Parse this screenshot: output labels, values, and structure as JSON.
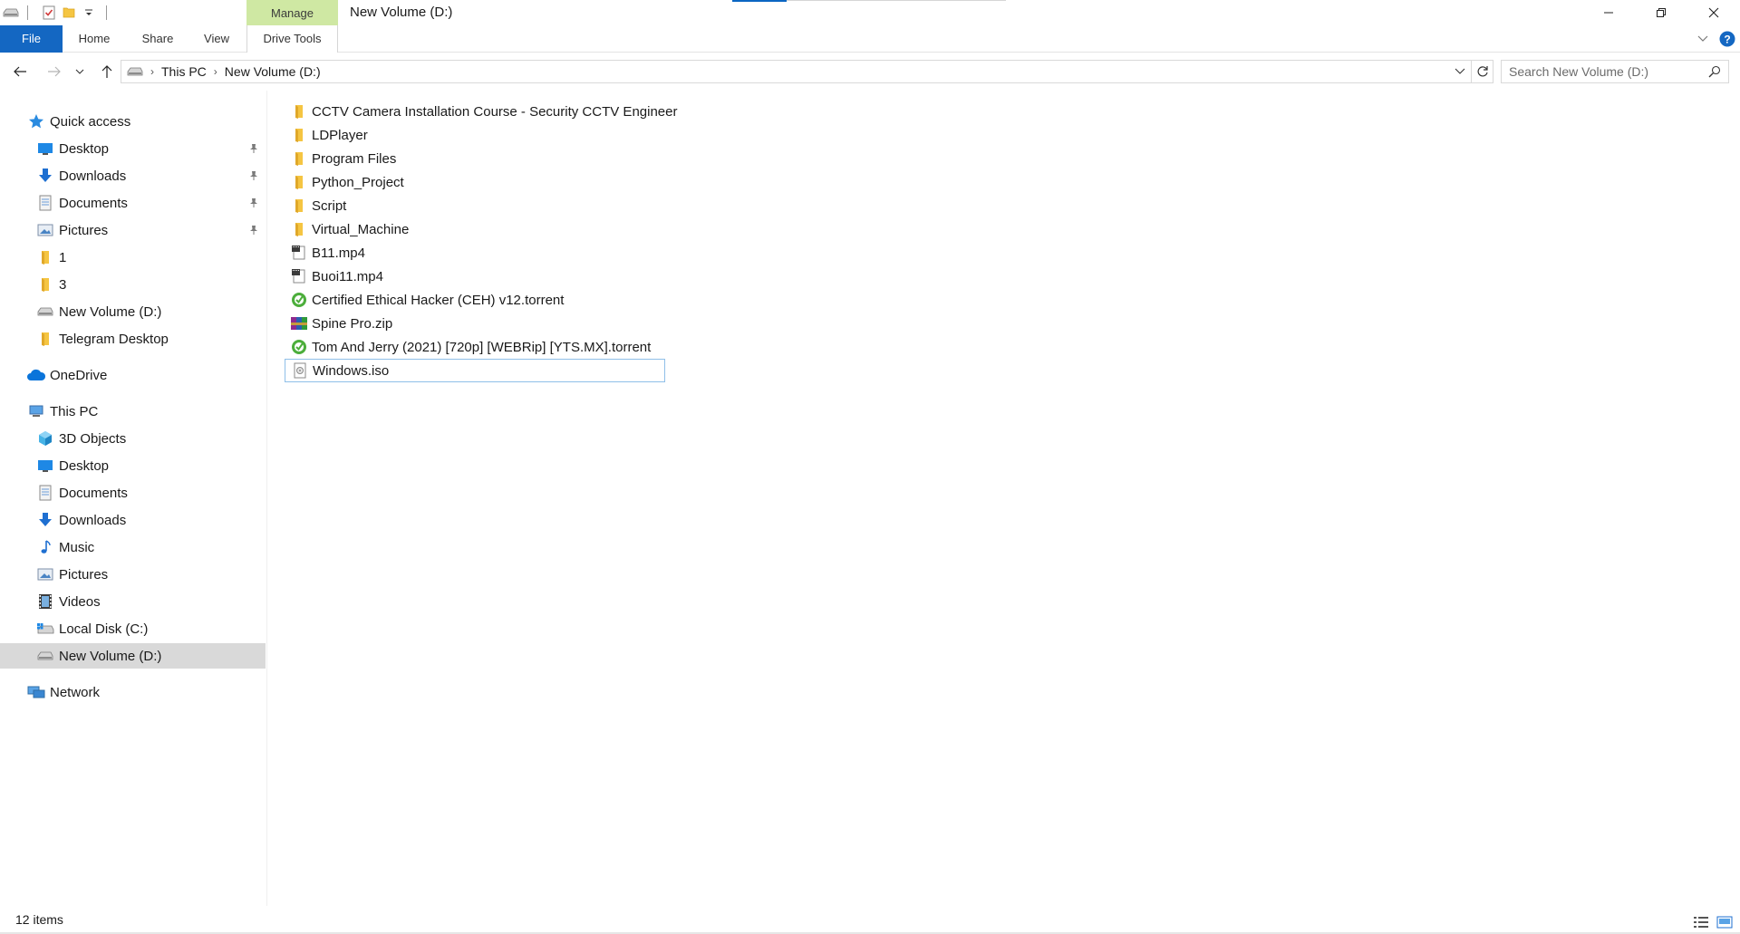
{
  "window": {
    "title": "New Volume (D:)",
    "context_tab": "Manage",
    "accent_color": "#0b66c2",
    "file_tab_color": "#1467c2",
    "manage_color": "#cfe8a3"
  },
  "ribbon": {
    "tabs": [
      "File",
      "Home",
      "Share",
      "View",
      "Drive Tools"
    ]
  },
  "address": {
    "crumbs": [
      "This PC",
      "New Volume (D:)"
    ],
    "search_placeholder": "Search New Volume (D:)"
  },
  "sidebar": {
    "quick_access": "Quick access",
    "quick_items": [
      {
        "label": "Desktop",
        "icon": "desktop-icon",
        "pinned": true
      },
      {
        "label": "Downloads",
        "icon": "downloads-icon",
        "pinned": true
      },
      {
        "label": "Documents",
        "icon": "documents-icon",
        "pinned": true
      },
      {
        "label": "Pictures",
        "icon": "pictures-icon",
        "pinned": true
      },
      {
        "label": "1",
        "icon": "folder-icon",
        "pinned": false
      },
      {
        "label": "3",
        "icon": "folder-icon",
        "pinned": false
      },
      {
        "label": "New Volume (D:)",
        "icon": "drive-icon",
        "pinned": false
      },
      {
        "label": "Telegram Desktop",
        "icon": "folder-icon",
        "pinned": false
      }
    ],
    "onedrive": "OneDrive",
    "this_pc": "This PC",
    "pc_items": [
      {
        "label": "3D Objects",
        "icon": "3d-objects-icon"
      },
      {
        "label": "Desktop",
        "icon": "desktop-icon"
      },
      {
        "label": "Documents",
        "icon": "documents-icon"
      },
      {
        "label": "Downloads",
        "icon": "downloads-icon"
      },
      {
        "label": "Music",
        "icon": "music-icon"
      },
      {
        "label": "Pictures",
        "icon": "pictures-icon"
      },
      {
        "label": "Videos",
        "icon": "videos-icon"
      },
      {
        "label": "Local Disk (C:)",
        "icon": "local-disk-icon"
      },
      {
        "label": "New Volume (D:)",
        "icon": "drive-icon"
      }
    ],
    "network": "Network"
  },
  "files": [
    {
      "name": "CCTV Camera Installation Course - Security CCTV Engineer",
      "icon": "folder-icon"
    },
    {
      "name": "LDPlayer",
      "icon": "folder-icon"
    },
    {
      "name": "Program Files",
      "icon": "folder-icon"
    },
    {
      "name": "Python_Project",
      "icon": "folder-icon"
    },
    {
      "name": "Script",
      "icon": "folder-icon"
    },
    {
      "name": "Virtual_Machine",
      "icon": "folder-icon"
    },
    {
      "name": "B11.mp4",
      "icon": "video-file-icon"
    },
    {
      "name": "Buoi11.mp4",
      "icon": "video-file-icon"
    },
    {
      "name": "Certified Ethical Hacker (CEH) v12.torrent",
      "icon": "torrent-icon"
    },
    {
      "name": "Spine Pro.zip",
      "icon": "archive-icon"
    },
    {
      "name": "Tom And Jerry (2021) [720p] [WEBRip] [YTS.MX].torrent",
      "icon": "torrent-icon"
    },
    {
      "name": "Windows.iso",
      "icon": "disc-image-icon"
    }
  ],
  "status": {
    "item_count": "12 items"
  }
}
